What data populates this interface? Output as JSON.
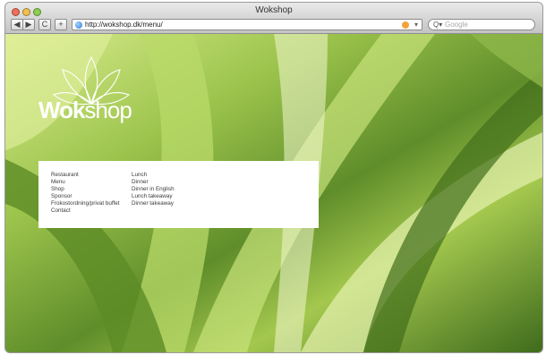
{
  "window": {
    "title": "Wokshop"
  },
  "toolbar": {
    "back_glyph": "◀",
    "forward_glyph": "▶",
    "reload_glyph": "C",
    "add_glyph": "+",
    "url": "http://wokshop.dk/menu/",
    "search_placeholder": "Google",
    "icons": [
      "back-icon",
      "forward-icon",
      "reload-icon",
      "add-bookmark-icon",
      "globe-icon",
      "rss-icon",
      "search-icon"
    ]
  },
  "site": {
    "logo_text_bold": "Wok",
    "logo_text_light": "shop",
    "menu_main": [
      "Restaurant",
      "Menu",
      "Shop",
      "Sponsor",
      "Frokostordning/privat buffet",
      "Contact"
    ],
    "menu_sub": [
      "Lunch",
      "Dinner",
      "Dinner in English",
      "Lunch takeaway",
      "Dinner takeaway"
    ]
  },
  "colors": {
    "accent_green": "#8fbf3e",
    "menu_panel": "#ffffff"
  }
}
